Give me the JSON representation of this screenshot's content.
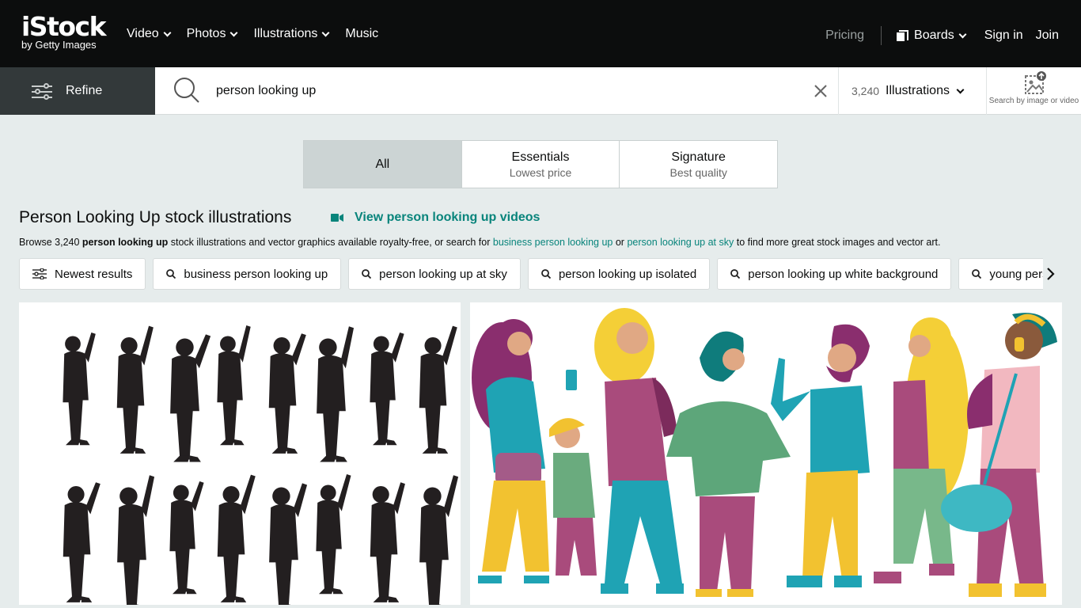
{
  "brand": {
    "name": "iStock",
    "byline": "by Getty Images"
  },
  "nav": {
    "items": [
      {
        "label": "Video"
      },
      {
        "label": "Photos"
      },
      {
        "label": "Illustrations"
      },
      {
        "label": "Music"
      }
    ],
    "pricing": "Pricing",
    "boards": "Boards",
    "signin": "Sign in",
    "join": "Join"
  },
  "search": {
    "refine_label": "Refine",
    "query": "person looking up",
    "result_count": "3,240",
    "asset_type": "Illustrations",
    "image_search_label": "Search by image or video"
  },
  "tabs": [
    {
      "title": "All",
      "subtitle": ""
    },
    {
      "title": "Essentials",
      "subtitle": "Lowest price"
    },
    {
      "title": "Signature",
      "subtitle": "Best quality"
    }
  ],
  "results": {
    "heading": "Person Looking Up stock illustrations",
    "video_link": "View person looking up videos",
    "browse": {
      "prefix": "Browse 3,240 ",
      "term": "person looking up",
      "middle": " stock illustrations and vector graphics available royalty-free, or search for ",
      "link1": "business person looking up",
      "or": " or ",
      "link2": "person looking up at sky",
      "suffix": " to find more great stock images and vector art."
    }
  },
  "chips": [
    {
      "label": "Newest results"
    },
    {
      "label": "business person looking up"
    },
    {
      "label": "person looking up at sky"
    },
    {
      "label": "person looking up isolated"
    },
    {
      "label": "person looking up white background"
    },
    {
      "label": "young person looking up"
    }
  ],
  "colors": {
    "topbar": "#0c0d0d",
    "accent_teal": "#08847b",
    "page_bg": "#e6ecec",
    "refine_bg": "#33393a"
  }
}
